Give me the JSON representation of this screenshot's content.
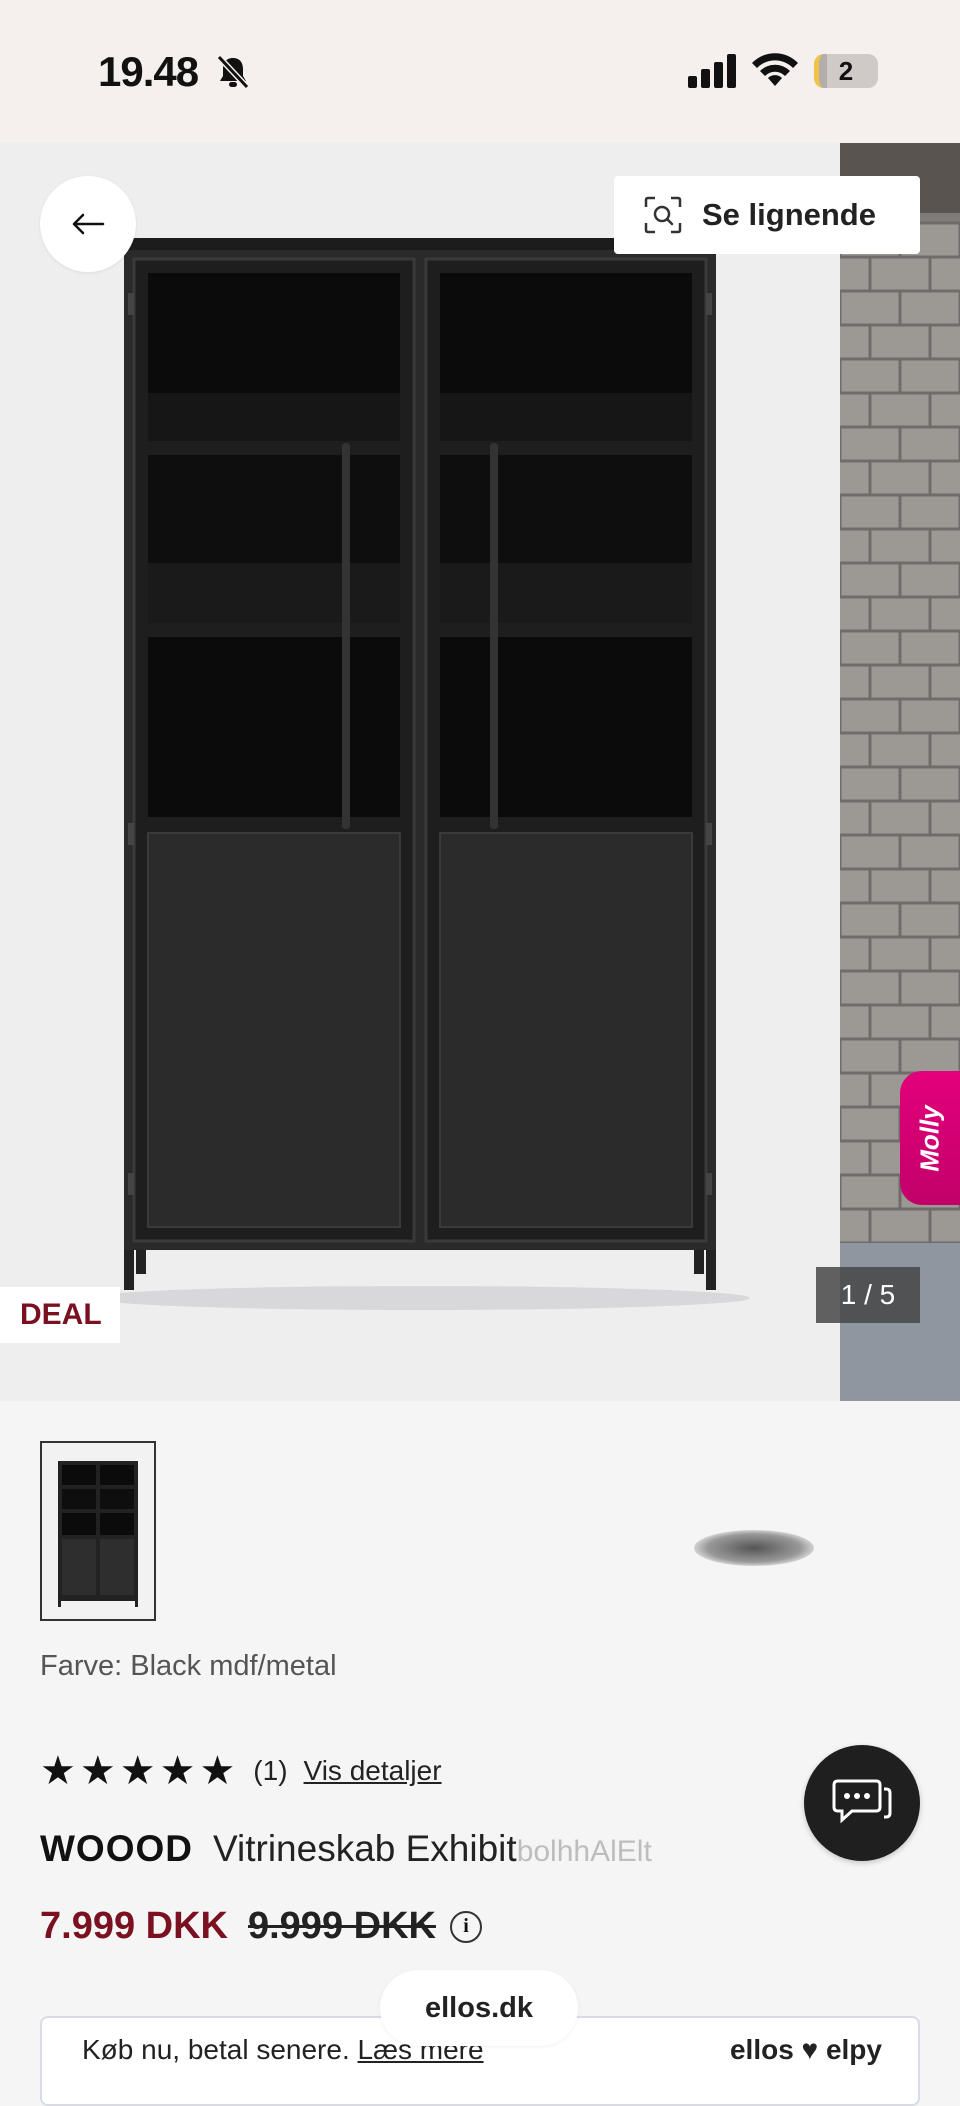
{
  "status_bar": {
    "time": "19.48",
    "battery": "2",
    "battery_fraction": 0.2
  },
  "gallery": {
    "similar_label": "Se lignende",
    "side_tab_label": "Molly",
    "deal_badge": "DEAL",
    "page_counter": "1 / 5"
  },
  "product": {
    "color_label": "Farve:",
    "color_value": "Black mdf/metal",
    "rating_stars": 5,
    "rating_count": "(1)",
    "details_link": "Vis detaljer",
    "brand": "WOOOD",
    "name": "Vitrineskab Exhibit",
    "name_overflow": "bolhhAlElt",
    "price_now": "7.999 DKK",
    "price_old": "9.999 DKK"
  },
  "payment": {
    "text": "Køb nu, betal senere.",
    "link": "Læs mere",
    "logo": "ellos ♥ elpy"
  },
  "browser": {
    "url": "ellos.dk"
  },
  "colors": {
    "accent": "#7a1020",
    "status_bg": "#f5efed",
    "molly": "#e4007b"
  },
  "icons": [
    "bell-slash-icon",
    "signal-icon",
    "wifi-icon",
    "battery-icon",
    "back-arrow-icon",
    "visual-search-icon",
    "star-icon",
    "info-icon",
    "chat-icon"
  ]
}
